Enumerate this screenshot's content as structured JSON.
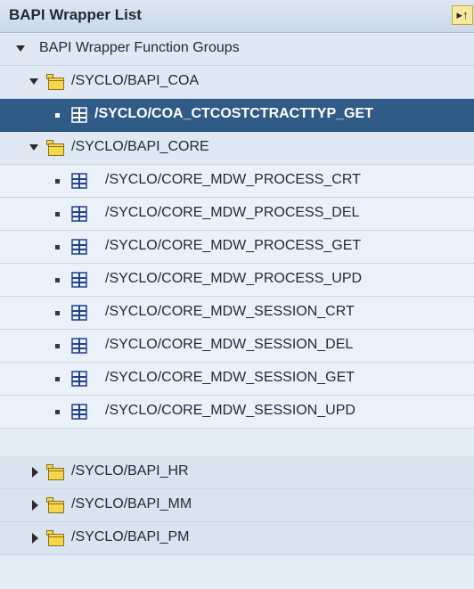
{
  "header": {
    "title": "BAPI Wrapper List",
    "button_glyph": "▸↑"
  },
  "root": {
    "label": "BAPI Wrapper Function Groups",
    "expanded": true
  },
  "groups": [
    {
      "label": "/SYCLO/BAPI_COA",
      "expanded": true
    },
    {
      "label": "/SYCLO/BAPI_CORE",
      "expanded": true
    },
    {
      "label": "/SYCLO/BAPI_HR",
      "expanded": false
    },
    {
      "label": "/SYCLO/BAPI_MM",
      "expanded": false
    },
    {
      "label": "/SYCLO/BAPI_PM",
      "expanded": false
    }
  ],
  "coa_items": [
    {
      "label": "/SYCLO/COA_CTCOSTCTRACTTYP_GET",
      "selected": true
    }
  ],
  "core_items": [
    {
      "label": "/SYCLO/CORE_MDW_PROCESS_CRT"
    },
    {
      "label": "/SYCLO/CORE_MDW_PROCESS_DEL"
    },
    {
      "label": "/SYCLO/CORE_MDW_PROCESS_GET"
    },
    {
      "label": "/SYCLO/CORE_MDW_PROCESS_UPD"
    },
    {
      "label": "/SYCLO/CORE_MDW_SESSION_CRT"
    },
    {
      "label": "/SYCLO/CORE_MDW_SESSION_DEL"
    },
    {
      "label": "/SYCLO/CORE_MDW_SESSION_GET"
    },
    {
      "label": "/SYCLO/CORE_MDW_SESSION_UPD"
    }
  ],
  "colors": {
    "selected_row": "#315b87",
    "folder_fill": "#f5d84a",
    "function_icon": "#1f3f8f"
  },
  "icons": {
    "folder": "folder-icon",
    "function": "function-module-icon",
    "expand": "triangle-expand-icon"
  }
}
